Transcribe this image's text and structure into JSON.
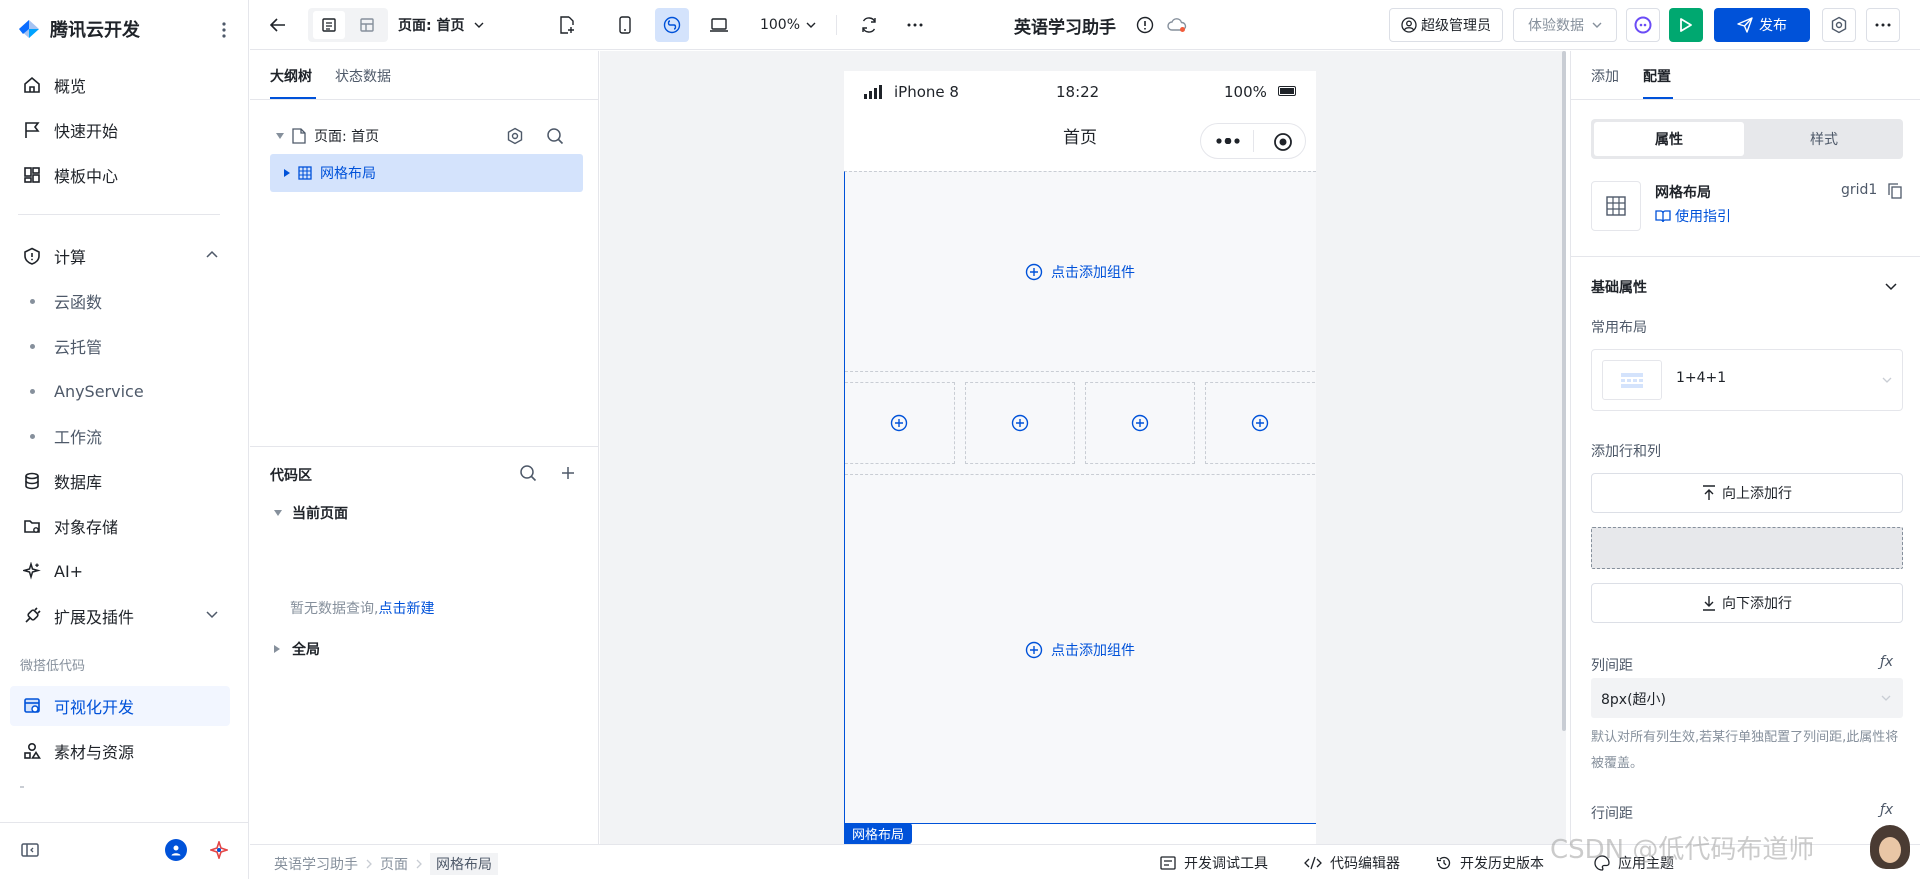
{
  "sidebar": {
    "brand": "腾讯云开发",
    "items": [
      {
        "label": "概览"
      },
      {
        "label": "快速开始"
      },
      {
        "label": "模板中心"
      },
      {
        "label": "计算"
      },
      {
        "label": "云函数"
      },
      {
        "label": "云托管"
      },
      {
        "label": "AnyService"
      },
      {
        "label": "工作流"
      },
      {
        "label": "数据库"
      },
      {
        "label": "对象存储"
      },
      {
        "label": "AI+"
      },
      {
        "label": "扩展及插件"
      },
      {
        "label": "可视化开发"
      },
      {
        "label": "素材与资源"
      }
    ],
    "group_label": "微搭低代码",
    "active_color": "#0052d9"
  },
  "topbar": {
    "page_select": "页面: 首页",
    "zoom": "100%",
    "app_title": "英语学习助手",
    "role_label": "超级管理员",
    "data_select": "体验数据",
    "publish_label": "发布",
    "primary_color": "#0052d9",
    "run_color": "#00a870"
  },
  "outline": {
    "tabs": [
      "大纲树",
      "状态数据"
    ],
    "page_node": "页面: 首页",
    "grid_node": "网格布局",
    "code_title": "代码区",
    "current_page": "当前页面",
    "empty_text": "暂无数据查询,",
    "create_link": "点击新建",
    "global": "全局"
  },
  "phone": {
    "carrier": "iPhone 8",
    "time": "18:22",
    "battery": "100%",
    "nav_title": "首页",
    "add_component": "点击添加组件",
    "add_component_2": "点击添加组件",
    "selected_label": "网格布局"
  },
  "right": {
    "tabs": [
      "添加",
      "配置"
    ],
    "seg_props": "属性",
    "seg_style": "样式",
    "comp_name": "网格布局",
    "comp_id": "grid1",
    "guide_link": "使用指引",
    "basic_props": "基础属性",
    "common_layout": "常用布局",
    "layout_value": "1+4+1",
    "add_rows_cols": "添加行和列",
    "add_row_up": "向上添加行",
    "add_row_down": "向下添加行",
    "col_gap": "列间距",
    "col_gap_value": "8px(超小)",
    "hint": "默认对所有列生效,若某行单独配置了列间距,此属性将被覆盖。",
    "row_gap": "行间距"
  },
  "bottom": {
    "crumbs": [
      "英语学习助手",
      "页面",
      "网格布局"
    ],
    "dev_tools": "开发调试工具",
    "code_editor": "代码编辑器",
    "history": "开发历史版本",
    "app_theme": "应用主题",
    "watermark": "CSDN @低代码布道师"
  }
}
